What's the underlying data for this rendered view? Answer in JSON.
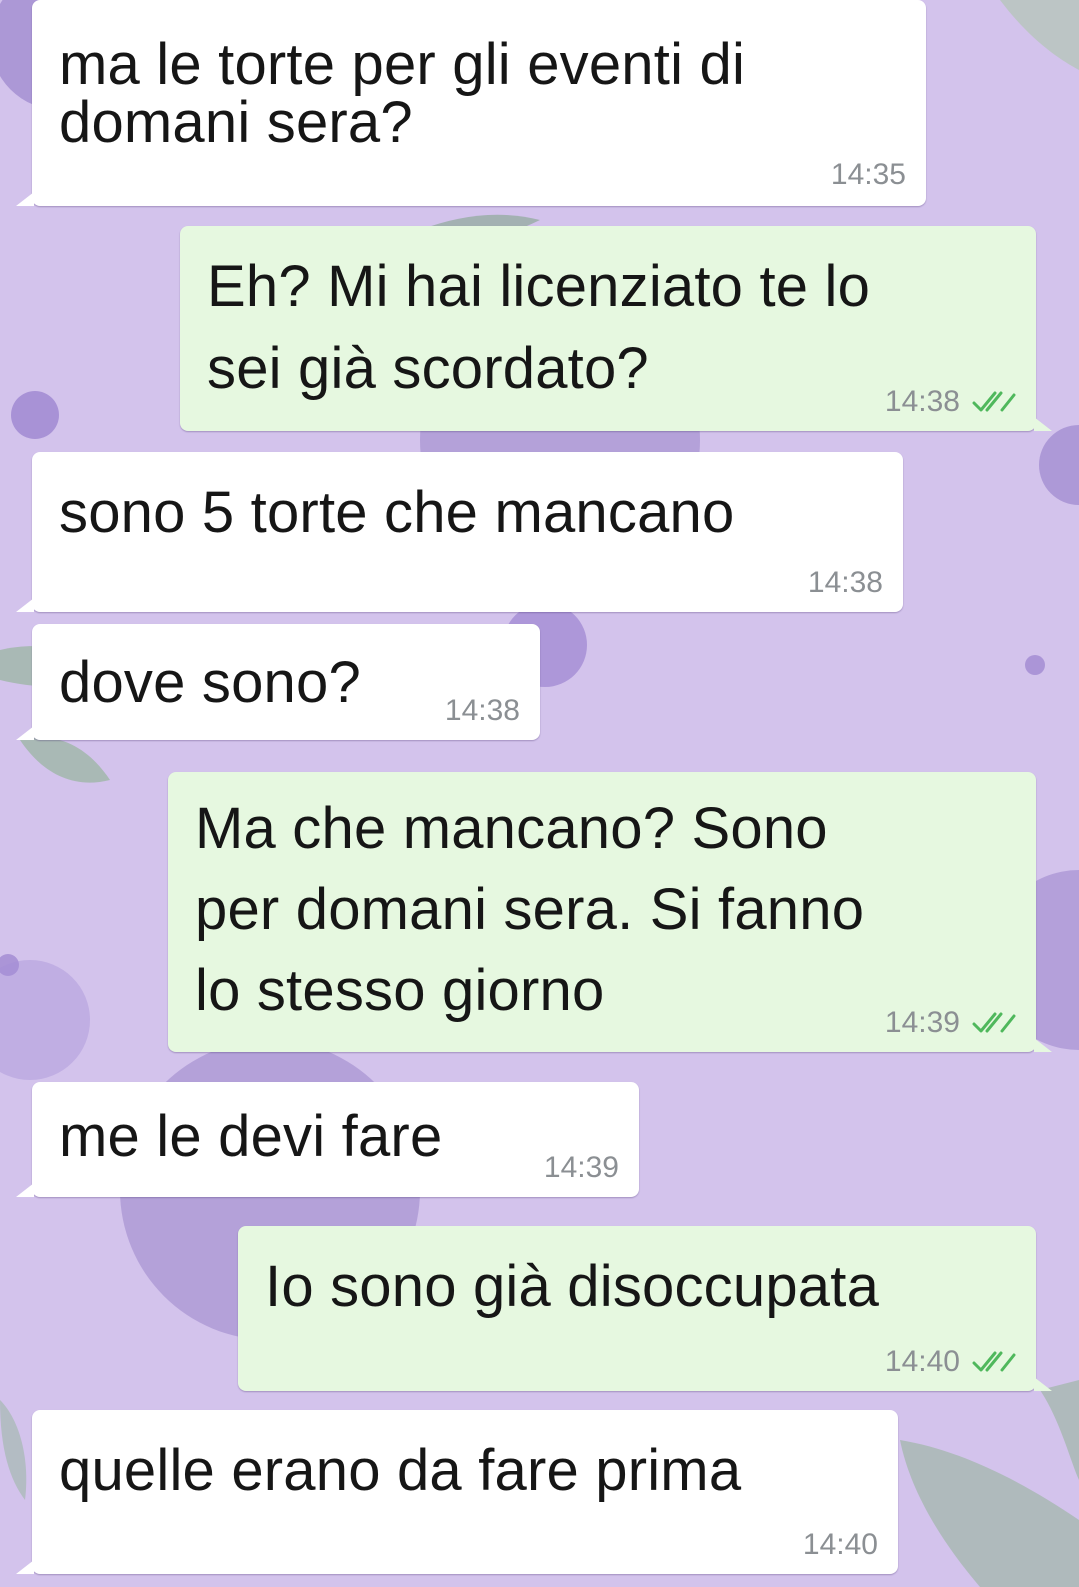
{
  "colors": {
    "wallpaper": "#d3c3ec",
    "incoming_bubble": "#ffffff",
    "outgoing_bubble": "#e6f8e0",
    "read_tick": "#4fb85c",
    "timestamp": "#8b8f93"
  },
  "icons": {
    "read_receipt": "double-check-icon"
  },
  "messages": [
    {
      "direction": "incoming",
      "lines": [
        "ma le torte per gli eventi di",
        "domani sera?"
      ],
      "time": "14:35"
    },
    {
      "direction": "outgoing",
      "lines": [
        "Eh? Mi hai licenziato te lo",
        "sei già scordato?"
      ],
      "time": "14:38",
      "status": "read"
    },
    {
      "direction": "incoming",
      "lines": [
        "sono 5 torte che mancano"
      ],
      "time": "14:38"
    },
    {
      "direction": "incoming",
      "lines": [
        "dove sono?"
      ],
      "time": "14:38"
    },
    {
      "direction": "outgoing",
      "lines": [
        "Ma che mancano? Sono",
        "per domani sera. Si fanno",
        "lo stesso giorno"
      ],
      "time": "14:39",
      "status": "read"
    },
    {
      "direction": "incoming",
      "lines": [
        "me le devi fare"
      ],
      "time": "14:39"
    },
    {
      "direction": "outgoing",
      "lines": [
        "Io sono già disoccupata"
      ],
      "time": "14:40",
      "status": "read"
    },
    {
      "direction": "incoming",
      "lines": [
        "quelle erano da fare prima"
      ],
      "time": "14:40"
    }
  ]
}
